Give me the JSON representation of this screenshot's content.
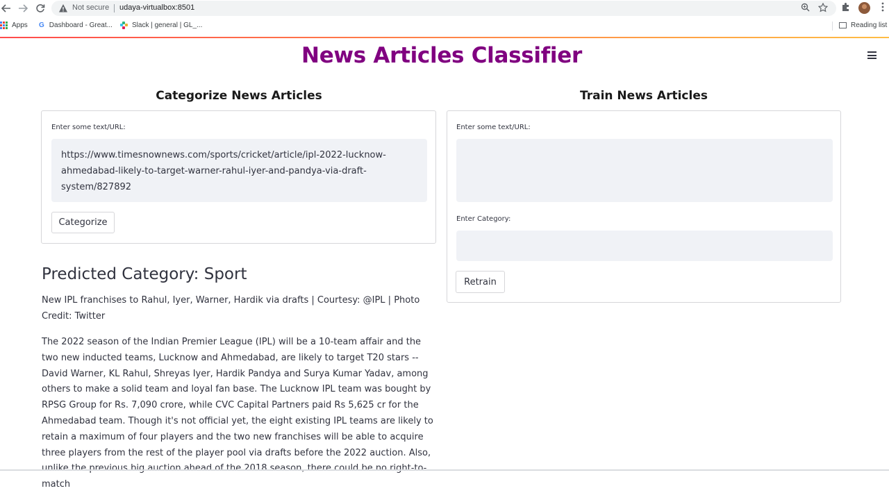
{
  "browser": {
    "not_secure": "Not secure",
    "url": "udaya-virtualbox:8501",
    "nav_icons": [
      "back-arrow-icon",
      "forward-arrow-icon",
      "reload-icon"
    ],
    "bookmarks": [
      "Apps",
      "Dashboard - Great...",
      "Slack | general | GL_..."
    ],
    "reading_list": "Reading list"
  },
  "app": {
    "title": "News Articles Classifier",
    "title_color": "#800080"
  },
  "categorize": {
    "heading": "Categorize News Articles",
    "input_label": "Enter some text/URL:",
    "input_value": "https://www.timesnownews.com/sports/cricket/article/ipl-2022-lucknow-ahmedabad-likely-to-target-warner-rahul-iyer-and-pandya-via-draft-system/827892",
    "button": "Categorize"
  },
  "result": {
    "predicted": "Predicted Category: Sport",
    "caption": "New IPL franchises to Rahul, Iyer, Warner, Hardik via drafts | Courtesy: @IPL  |  Photo Credit: Twitter",
    "body": "The 2022 season of the Indian Premier League (IPL) will be a 10-team affair and the two new inducted teams, Lucknow and Ahmedabad, are likely to target T20 stars -- David Warner, KL Rahul, Shreyas Iyer, Hardik Pandya and Surya Kumar Yadav, among others to make a solid team and loyal fan base. The Lucknow IPL team was bought by RPSG Group for Rs. 7,090 crore, while CVC Capital Partners paid Rs 5,625 cr for the Ahmedabad team. Though it's not official yet, the eight existing IPL teams are likely to retain a maximum of four players and the two new franchises will be able to acquire three players from the rest of the player pool via drafts before the 2022 auction. Also, unlike the previous big auction ahead of the 2018 season, there could be no right-to-match"
  },
  "train": {
    "heading": "Train News Articles",
    "text_label": "Enter some text/URL:",
    "text_value": "",
    "category_label": "Enter Category:",
    "category_value": "",
    "button": "Retrain"
  }
}
